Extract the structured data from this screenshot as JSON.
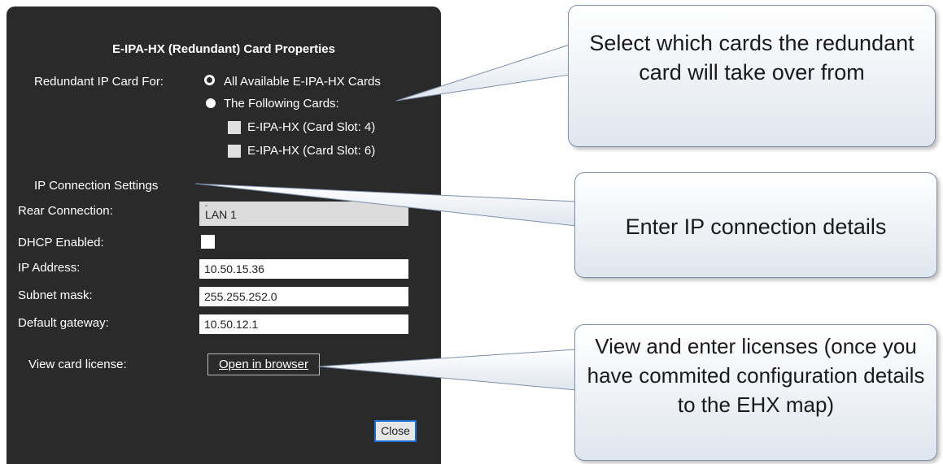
{
  "dialog": {
    "title": "E-IPA-HX (Redundant) Card Properties",
    "redundant_label": "Redundant IP Card For:",
    "option_all": "All Available E-IPA-HX Cards",
    "option_following": "The Following Cards:",
    "card_slot_4": "E-IPA-HX (Card Slot: 4)",
    "card_slot_6": "E-IPA-HX (Card Slot: 6)",
    "section_ip": "IP Connection Settings",
    "rear_connection_label": "Rear Connection:",
    "rear_connection_value": "LAN 1",
    "dhcp_label": "DHCP Enabled:",
    "ip_label": "IP Address:",
    "ip_value": "10.50.15.36",
    "subnet_label": "Subnet mask:",
    "subnet_value": "255.255.252.0",
    "gateway_label": "Default gateway:",
    "gateway_value": "10.50.12.1",
    "license_label": "View card license:",
    "license_button": "Open in browser",
    "close_button": "Close"
  },
  "callouts": {
    "select_cards": "Select which cards the redundant card will take over from",
    "enter_ip": "Enter IP connection details",
    "licenses": "View and enter licenses (once you have commited configuration details to the EHX map)"
  }
}
